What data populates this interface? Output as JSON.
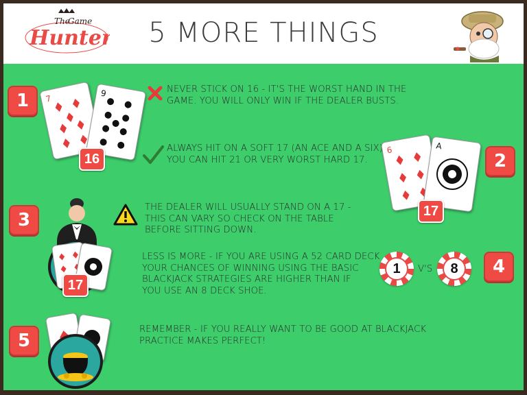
{
  "header": {
    "title": "5 MORE THINGS",
    "logo": {
      "line1": "The",
      "line2": "Game",
      "line3": "Hunter"
    }
  },
  "colors": {
    "panel": "#3dcd6b",
    "accent": "#f04a45",
    "frame": "#3a2a20"
  },
  "tips": [
    {
      "number": "1",
      "line1": "NEVER STICK ON 16 - IT'S THE WORST HAND IN THE",
      "line2": "GAME. YOU WILL ONLY WIN IF THE DEALER BUSTS.",
      "icon": "x-mark-icon"
    },
    {
      "number": "2",
      "line1": "ALWAYS HIT ON A SOFT 17 (AN ACE AND A SIX)",
      "line2": "YOU CAN HIT 21 OR VERY WORST HARD 17.",
      "icon": "checkmark-icon"
    },
    {
      "number": "3",
      "line1": "THE DEALER WILL USUALLY STAND ON A 17 -",
      "line2": "THIS CAN VARY SO CHECK ON THE TABLE",
      "line3": "BEFORE SITTING DOWN.",
      "icon": "warning-icon"
    },
    {
      "number": "4",
      "line1": "LESS IS MORE - IF YOU ARE USING A 52 CARD DECK",
      "line2": "YOUR CHANCES OF WINNING USING THE BASIC",
      "line3": "BLACKJACK STRATEGIES ARE HIGHER THAN IF",
      "line4": "YOU USE AN 8 DECK SHOE."
    },
    {
      "number": "5",
      "line1": "REMEMBER - IF YOU REALLY  WANT TO BE GOOD AT BLACKJACK",
      "line2": "PRACTICE MAKES PERFECT!"
    }
  ],
  "hands": {
    "hand1": {
      "score": "16",
      "card_a": "7",
      "card_b": "9"
    },
    "hand2": {
      "score": "17",
      "card_a": "6",
      "card_b": "A"
    },
    "hand3": {
      "score": "17"
    }
  },
  "chips": {
    "left": "1",
    "vs": "V'S",
    "right": "8"
  }
}
